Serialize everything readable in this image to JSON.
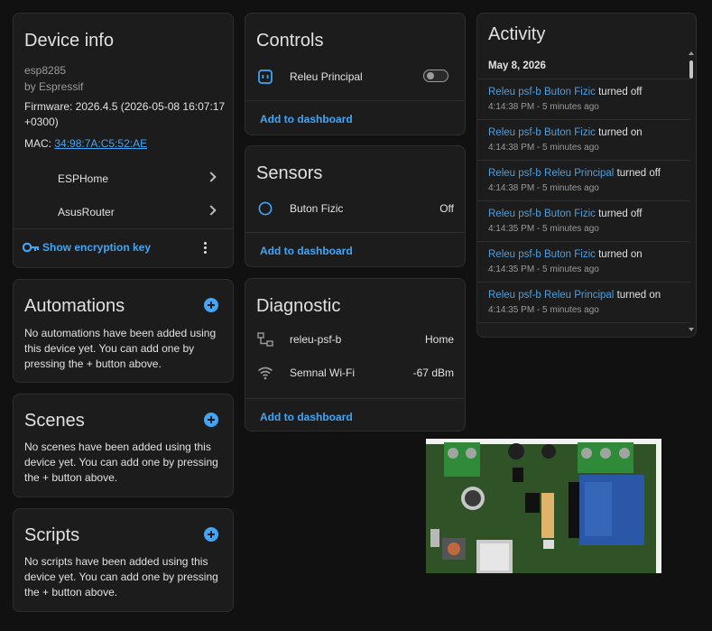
{
  "device_info": {
    "title": "Device info",
    "model": "esp8285",
    "manufacturer": "by Espressif",
    "firmware_line1": "Firmware: 2026.4.5 (2026-05-08 16:07:17",
    "firmware_line2": "+0300)",
    "mac_label": "MAC: ",
    "mac_value": "34:98:7A:C5:52:AE",
    "nav_items": [
      {
        "label": "ESPHome"
      },
      {
        "label": "AsusRouter"
      }
    ],
    "encryption_label": "Show encryption key"
  },
  "automations": {
    "title": "Automations",
    "text": "No automations have been added using this device yet. You can add one by pressing the + button above."
  },
  "scenes": {
    "title": "Scenes",
    "text": "No scenes have been added using this device yet. You can add one by pressing the + button above."
  },
  "scripts": {
    "title": "Scripts",
    "text": "No scripts have been added using this device yet. You can add one by pressing the + button above."
  },
  "controls": {
    "title": "Controls",
    "entity_label": "Releu Principal",
    "add_label": "Add to dashboard"
  },
  "sensors": {
    "title": "Sensors",
    "entity_label": "Buton Fizic",
    "entity_state": "Off",
    "add_label": "Add to dashboard"
  },
  "diagnostic": {
    "title": "Diagnostic",
    "items": [
      {
        "label": "releu-psf-b",
        "state": "Home"
      },
      {
        "label": "Semnal Wi-Fi",
        "state": "-67 dBm"
      }
    ],
    "add_label": "Add to dashboard"
  },
  "activity": {
    "title": "Activity",
    "date": "May 8, 2026",
    "entries": [
      {
        "device": "Releu psf-b",
        "entity": "Buton Fizic",
        "action": "turned off",
        "time": "4:14:38 PM - 5 minutes ago"
      },
      {
        "device": "Releu psf-b",
        "entity": "Buton Fizic",
        "action": "turned on",
        "time": "4:14:38 PM - 5 minutes ago"
      },
      {
        "device": "Releu psf-b",
        "entity": "Releu Principal",
        "action": "turned off",
        "time": "4:14:38 PM - 5 minutes ago"
      },
      {
        "device": "Releu psf-b",
        "entity": "Buton Fizic",
        "action": "turned off",
        "time": "4:14:35 PM - 5 minutes ago"
      },
      {
        "device": "Releu psf-b",
        "entity": "Buton Fizic",
        "action": "turned on",
        "time": "4:14:35 PM - 5 minutes ago"
      },
      {
        "device": "Releu psf-b",
        "entity": "Releu Principal",
        "action": "turned on",
        "time": "4:14:35 PM - 5 minutes ago"
      }
    ]
  },
  "colors": {
    "accent": "#42a5f5",
    "background": "#111111",
    "card": "#1c1c1c"
  }
}
